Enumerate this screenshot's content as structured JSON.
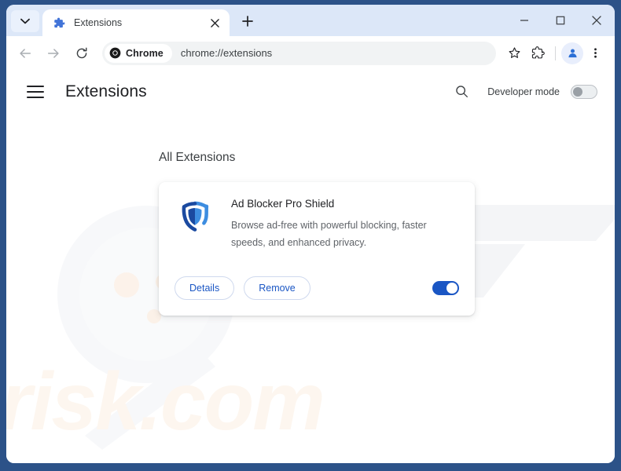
{
  "browser": {
    "tab": {
      "title": "Extensions",
      "favicon": "puzzle-piece-icon",
      "close_label": "×"
    },
    "new_tab_label": "+",
    "tab_search_icon": "chevron-down-icon",
    "window_controls": {
      "minimize": "–",
      "maximize": "□",
      "close": "×"
    },
    "toolbar": {
      "back_icon": "arrow-left-icon",
      "forward_icon": "arrow-right-icon",
      "reload_icon": "reload-icon",
      "chrome_chip_label": "Chrome",
      "url": "chrome://extensions",
      "bookmark_icon": "star-icon",
      "extensions_icon": "puzzle-piece-icon",
      "profile_icon": "person-avatar-icon",
      "menu_icon": "three-dots-vertical-icon"
    }
  },
  "page": {
    "menu_icon": "hamburger-menu-icon",
    "title": "Extensions",
    "search_icon": "search-icon",
    "developer_mode": {
      "label": "Developer mode",
      "state": "off"
    },
    "section_title": "All Extensions",
    "extension": {
      "icon": "blue-shield-icon",
      "name": "Ad Blocker Pro Shield",
      "description": "Browse ad-free with powerful blocking, faster speeds, and enhanced privacy.",
      "details_label": "Details",
      "remove_label": "Remove",
      "enabled_state": "on"
    },
    "watermarks": {
      "magnifier": "magnifying-glass-watermark",
      "logo": "pc-logo-watermark",
      "text": "risk.com"
    }
  },
  "colors": {
    "frame": "#2c5288",
    "tabstrip": "#dce7f8",
    "accent_blue": "#1a56c4",
    "shield_dark": "#1b4aa0",
    "shield_light": "#3d8de0",
    "text_primary": "#202124",
    "text_secondary": "#5f6368",
    "watermark_cream": "#fdf6ef"
  }
}
